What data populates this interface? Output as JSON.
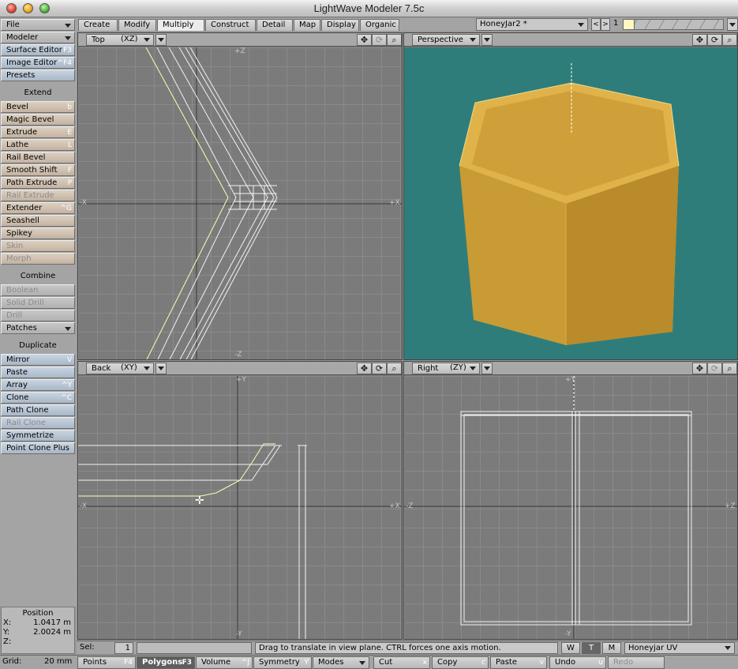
{
  "app": {
    "title": "LightWave Modeler 7.5c"
  },
  "left_toolbar": {
    "file": "File",
    "modeler": "Modeler",
    "surface_editor": {
      "label": "Surface Editor",
      "key": "F3"
    },
    "image_editor": {
      "label": "Image Editor",
      "key": "^F4"
    },
    "presets": "Presets",
    "extend_header": "Extend",
    "extend_items": [
      {
        "label": "Bevel",
        "key": "b",
        "enabled": true
      },
      {
        "label": "Magic Bevel",
        "key": "",
        "enabled": true
      },
      {
        "label": "Extrude",
        "key": "E",
        "enabled": true
      },
      {
        "label": "Lathe",
        "key": "L",
        "enabled": true
      },
      {
        "label": "Rail Bevel",
        "key": "",
        "enabled": true
      },
      {
        "label": "Smooth Shift",
        "key": "F",
        "enabled": true
      },
      {
        "label": "Path Extrude",
        "key": "P",
        "enabled": true
      },
      {
        "label": "Rail Extrude",
        "key": "",
        "enabled": false
      },
      {
        "label": "Extender",
        "key": "^G",
        "enabled": true
      },
      {
        "label": "Seashell",
        "key": "",
        "enabled": true
      },
      {
        "label": "Spikey",
        "key": "",
        "enabled": true
      },
      {
        "label": "Skin",
        "key": "",
        "enabled": false
      },
      {
        "label": "Morph",
        "key": "",
        "enabled": false
      }
    ],
    "combine_header": "Combine",
    "combine_items": [
      {
        "label": "Boolean",
        "key": "",
        "enabled": false
      },
      {
        "label": "Solid Drill",
        "key": "",
        "enabled": false
      },
      {
        "label": "Drill",
        "key": "",
        "enabled": false
      },
      {
        "label": "Patches",
        "key": "",
        "enabled": true
      }
    ],
    "duplicate_header": "Duplicate",
    "duplicate_items": [
      {
        "label": "Mirror",
        "key": "V",
        "enabled": true
      },
      {
        "label": "Paste",
        "key": "",
        "enabled": true
      },
      {
        "label": "Array",
        "key": "^Y",
        "enabled": true
      },
      {
        "label": "Clone",
        "key": "^C",
        "enabled": true
      },
      {
        "label": "Path Clone",
        "key": "",
        "enabled": true
      },
      {
        "label": "Rail Clone",
        "key": "",
        "enabled": false
      },
      {
        "label": "Symmetrize",
        "key": "",
        "enabled": true
      },
      {
        "label": "Point Clone Plus",
        "key": "",
        "enabled": true
      }
    ]
  },
  "position": {
    "title": "Position",
    "x_label": "X:",
    "x": "1.0417 m",
    "y_label": "Y:",
    "y": "2.0024 m",
    "z_label": "Z:",
    "z": ""
  },
  "tabs": [
    "Create",
    "Modify",
    "Multiply",
    "Construct",
    "Detail",
    "Map",
    "Display",
    "Organic"
  ],
  "active_tab": "Multiply",
  "object": {
    "name": "HoneyJar2 *",
    "layer": "1",
    "prev": "<",
    "next": ">"
  },
  "viewports": {
    "top": {
      "mode": "Top",
      "axes": "(XZ)",
      "labels": {
        "up": "+Z",
        "down": "-Z",
        "left": "-X",
        "right": "+X"
      }
    },
    "perspective": {
      "mode": "Perspective"
    },
    "back": {
      "mode": "Back",
      "axes": "(XY)",
      "labels": {
        "up": "+Y",
        "down": "-Y",
        "left": "-X",
        "right": "+X"
      }
    },
    "right": {
      "mode": "Right",
      "axes": "(ZY)",
      "labels": {
        "up": "+Y",
        "down": "-Y",
        "left": "-Z",
        "right": "+Z"
      }
    }
  },
  "status": {
    "sel_label": "Sel:",
    "sel_value": "1",
    "message": "Drag to translate in view plane. CTRL forces one axis motion.",
    "w": "W",
    "t": "T",
    "m": "M",
    "uv_map": "Honeyjar UV"
  },
  "bottom": {
    "grid_label": "Grid:",
    "grid_value": "20 mm",
    "points": {
      "label": "Points",
      "key": "F4"
    },
    "polygons": {
      "label": "Polygons",
      "key": "F3"
    },
    "volume": {
      "label": "Volume",
      "key": "^J"
    },
    "symmetry": {
      "label": "Symmetry",
      "key": "Y"
    },
    "modes": "Modes",
    "cut": {
      "label": "Cut",
      "key": "x"
    },
    "copy": {
      "label": "Copy",
      "key": "c"
    },
    "paste": {
      "label": "Paste",
      "key": "v"
    },
    "undo": {
      "label": "Undo",
      "key": "u"
    },
    "redo": "Redo"
  },
  "colors": {
    "perspective_bg": "#2e7d7b",
    "jar": "#d4a53c",
    "wire": "#f2f2f2",
    "selected": "#ffffb0"
  }
}
